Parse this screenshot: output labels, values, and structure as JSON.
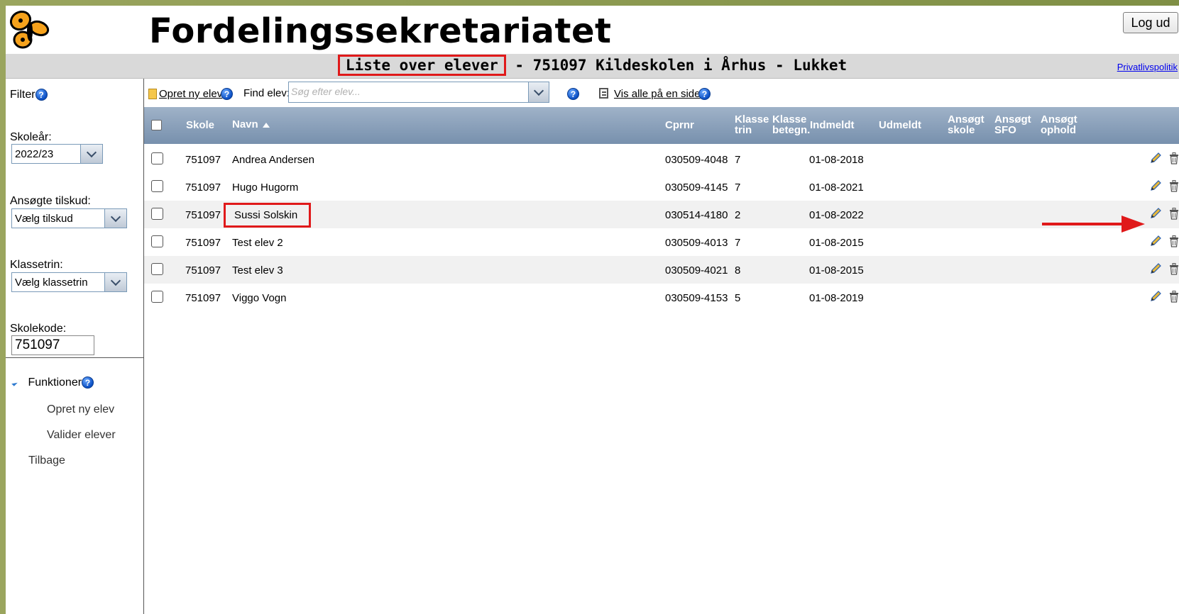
{
  "header": {
    "title": "Fordelingssekretariatet",
    "logout": "Log ud",
    "logo_icon": "butterfly-logo"
  },
  "subheader": {
    "title_highlight": "Liste over elever",
    "title_rest": " - 751097 Kildeskolen i Århus - Lukket",
    "privacy_link": "Privatlivspolitik"
  },
  "sidebar": {
    "filter_label": "Filter",
    "schoolyear_label": "Skoleår:",
    "schoolyear_value": "2022/23",
    "grant_label": "Ansøgte tilskud:",
    "grant_value": "Vælg tilskud",
    "grade_label": "Klassetrin:",
    "grade_value": "Vælg klassetrin",
    "schoolcode_label": "Skolekode:",
    "schoolcode_value": "751097",
    "functions_label": "Funktioner",
    "functions": [
      "Opret ny elev",
      "Valider elever"
    ],
    "back": "Tilbage"
  },
  "toolbar": {
    "create_label": "Opret ny elev",
    "find_label": "Find elev:",
    "find_placeholder": "Søg efter elev...",
    "show_all_label": "Vis alle på en side"
  },
  "table": {
    "columns": {
      "skole": "Skole",
      "navn": "Navn",
      "cprnr": "Cprnr",
      "klasse_trin": [
        "Klasse",
        "trin"
      ],
      "klasse_betegn": [
        "Klasse",
        "betegn."
      ],
      "indmeldt": "Indmeldt",
      "udmeldt": "Udmeldt",
      "ansogt_skole": [
        "Ansøgt",
        "skole"
      ],
      "ansogt_sfo": [
        "Ansøgt",
        "SFO"
      ],
      "ansogt_ophold": [
        "Ansøgt",
        "ophold"
      ]
    },
    "rows": [
      {
        "skole": "751097",
        "navn": "Andrea Andersen",
        "cpr": "030509-4048",
        "trin": "7",
        "indmeldt": "01-08-2018"
      },
      {
        "skole": "751097",
        "navn": "Hugo Hugorm",
        "cpr": "030509-4145",
        "trin": "7",
        "indmeldt": "01-08-2021"
      },
      {
        "skole": "751097",
        "navn": "Sussi Solskin",
        "cpr": "030514-4180",
        "trin": "2",
        "indmeldt": "01-08-2022"
      },
      {
        "skole": "751097",
        "navn": "Test elev 2",
        "cpr": "030509-4013",
        "trin": "7",
        "indmeldt": "01-08-2015"
      },
      {
        "skole": "751097",
        "navn": "Test elev 3",
        "cpr": "030509-4021",
        "trin": "8",
        "indmeldt": "01-08-2015"
      },
      {
        "skole": "751097",
        "navn": "Viggo Vogn",
        "cpr": "030509-4153",
        "trin": "5",
        "indmeldt": "01-08-2019"
      }
    ]
  },
  "colors": {
    "highlight": "#e0191a",
    "header_bar": "#d9d9d9",
    "table_header": "#7790ad"
  }
}
